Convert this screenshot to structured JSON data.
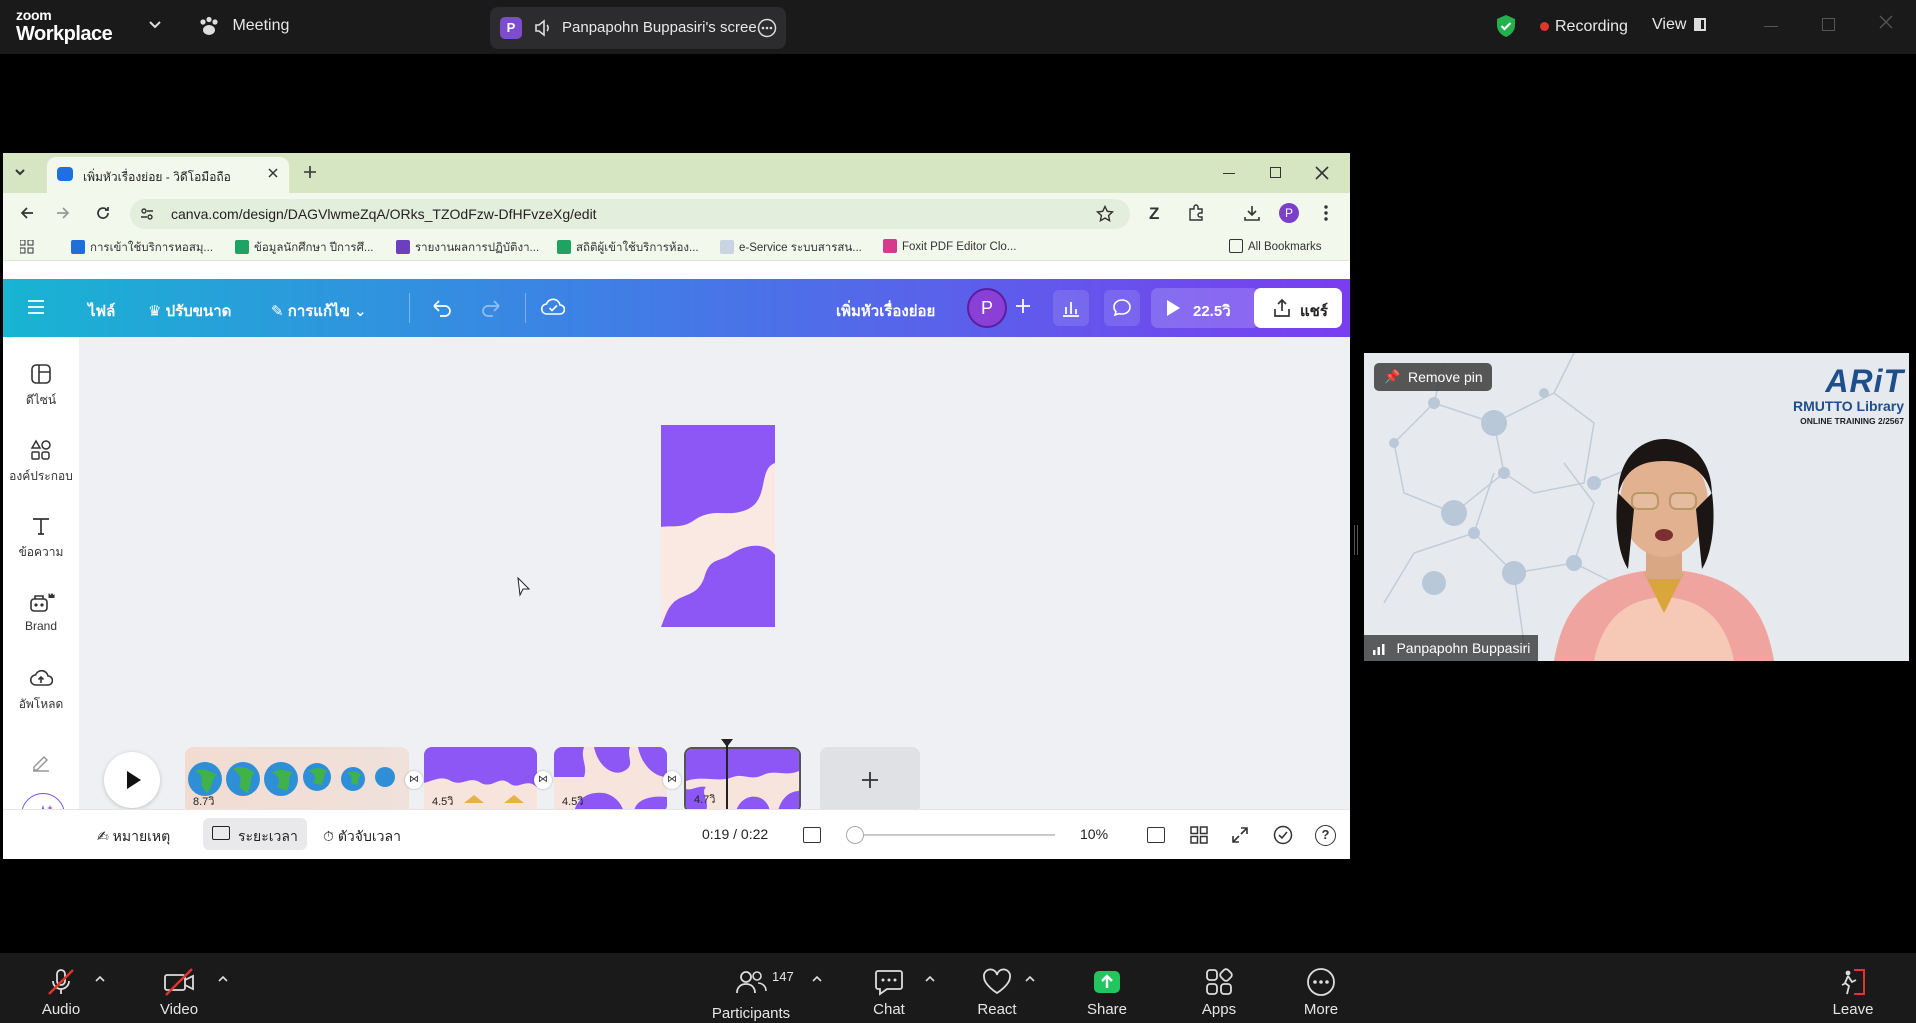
{
  "zoom_header": {
    "logo_line1": "zoom",
    "logo_line2": "Workplace",
    "meeting_label": "Meeting",
    "share_avatar_initial": "P",
    "share_label": "Panpapohn Buppasiri's scree",
    "recording_label": "Recording",
    "view_label": "View"
  },
  "browser": {
    "tab_title": "เพิ่มหัวเรื่องย่อย - วิดีโอมือถือ",
    "url": "canva.com/design/DAGVlwmeZqA/ORks_TZOdFzw-DfHFvzeXg/edit",
    "profile_initial": "P",
    "bookmarks": [
      {
        "label": "การเข้าใช้บริการหอสมุ..."
      },
      {
        "label": "ข้อมูลนักศึกษา ปีการศึ..."
      },
      {
        "label": "รายงานผลการปฏิบัติงา..."
      },
      {
        "label": "สถิติผู้เข้าใช้บริการห้อง..."
      },
      {
        "label": "e-Service ระบบสารสน..."
      },
      {
        "label": "Foxit PDF Editor Clo..."
      }
    ],
    "all_bookmarks": "All Bookmarks"
  },
  "canva": {
    "toolbar": {
      "file": "ไฟล์",
      "resize": "ปรับขนาด",
      "edit": "การแก้ไข",
      "design_title": "เพิ่มหัวเรื่องย่อย",
      "avatar_initial": "P",
      "play_duration": "22.5วิ",
      "share": "แชร์"
    },
    "sidebar": [
      {
        "label": "ดีไซน์"
      },
      {
        "label": "องค์ประกอบ"
      },
      {
        "label": "ข้อความ"
      },
      {
        "label": "Brand"
      },
      {
        "label": "อัพโหลด"
      }
    ],
    "clips": [
      {
        "duration": "8.7วิ"
      },
      {
        "duration": "4.5วิ"
      },
      {
        "duration": "4.5วิ"
      },
      {
        "duration": "4.7วิ"
      }
    ],
    "bottom": {
      "notes": "หมายเหตุ",
      "timeline": "ระยะเวลา",
      "timer": "ตัวจับเวลา",
      "time_readout": "0:19 / 0:22",
      "zoom_level": "10%"
    }
  },
  "video_tile": {
    "remove_pin": "Remove pin",
    "brand_logo": "ARiT",
    "brand_name": "RMUTTO Library",
    "brand_sub": "ONLINE TRAINING 2/2567",
    "participant_name": "Panpapohn Buppasiri"
  },
  "zoom_controls": {
    "audio": "Audio",
    "video": "Video",
    "participants_count": "147",
    "participants": "Participants",
    "chat": "Chat",
    "react": "React",
    "share": "Share",
    "apps": "Apps",
    "more": "More",
    "leave": "Leave"
  }
}
